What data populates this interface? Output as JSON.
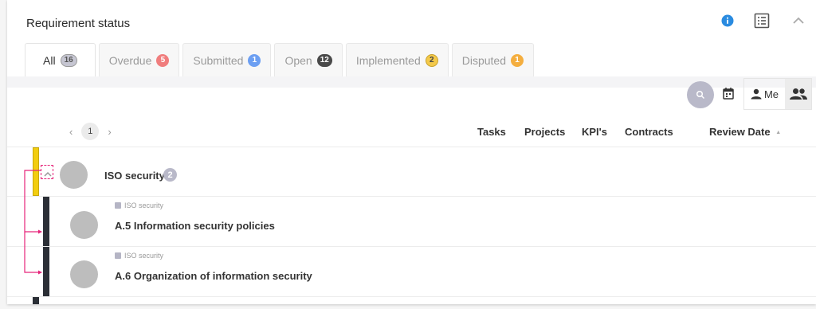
{
  "header": {
    "title": "Requirement status",
    "info_icon": "info-icon",
    "list_icon": "list-view-icon",
    "collapse_icon": "chevron-up-icon"
  },
  "tabs": [
    {
      "label": "All",
      "count": "16",
      "color": "#c6c6d2",
      "active": true
    },
    {
      "label": "Overdue",
      "count": "5",
      "color": "#f07d7d",
      "active": false
    },
    {
      "label": "Submitted",
      "count": "1",
      "color": "#6c9ff2",
      "active": false
    },
    {
      "label": "Open",
      "count": "12",
      "color": "#4a4a4a",
      "active": false
    },
    {
      "label": "Implemented",
      "count": "2",
      "color": "#f3c94a",
      "active": false
    },
    {
      "label": "Disputed",
      "count": "1",
      "color": "#f4ae3f",
      "active": false
    }
  ],
  "toolbar": {
    "me_label": "Me"
  },
  "pager": {
    "prev": "‹",
    "page": "1",
    "next": "›"
  },
  "columns": {
    "tasks": "Tasks",
    "projects": "Projects",
    "kpis": "KPI's",
    "contracts": "Contracts",
    "review_date": "Review Date",
    "sort_indicator": "▲"
  },
  "group": {
    "name": "ISO security",
    "count": "2",
    "status_color": "#f2cd10"
  },
  "children": [
    {
      "crumb": "ISO security",
      "name": "A.5 Information security policies",
      "status_color": "#2b2f36"
    },
    {
      "crumb": "ISO security",
      "name": "A.6 Organization of information security",
      "status_color": "#2b2f36"
    }
  ],
  "colors": {
    "accent_annotation": "#e6247a",
    "info_blue": "#2a8be0"
  }
}
